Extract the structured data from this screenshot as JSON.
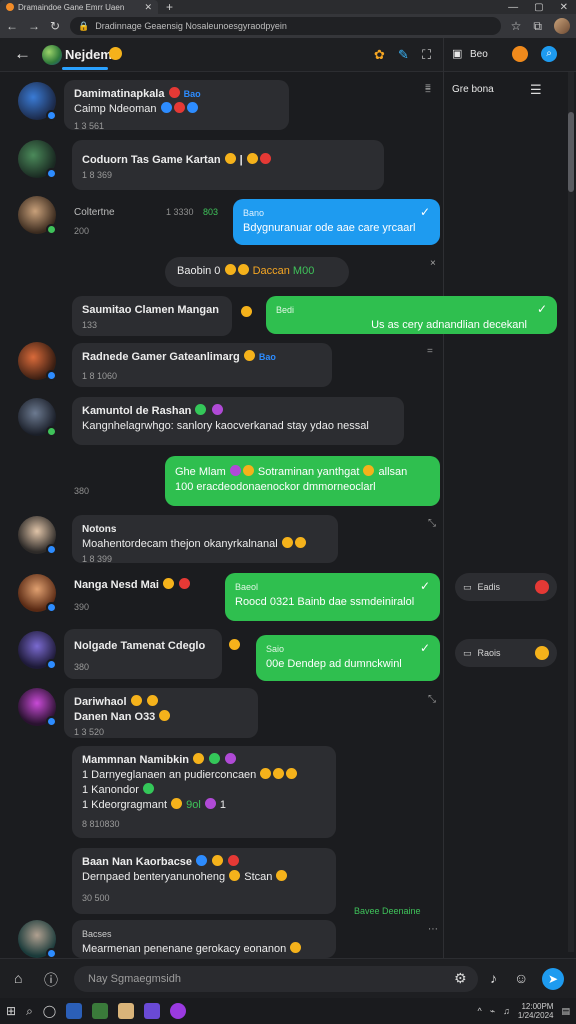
{
  "browser": {
    "tab_title": "Dramaindoe Gane Emrr Uaen",
    "address": "Dradinnage Geaensig Nosaleunoesgyraodpyein",
    "window_controls": [
      "—",
      "▢",
      "✕"
    ]
  },
  "header": {
    "back_icon": "←",
    "group_name": "Nejdem",
    "right_label": "Beo"
  },
  "right_panel": {
    "top_label": "Gre bona",
    "chips": [
      {
        "label": "Eadis",
        "color": "#e53935"
      },
      {
        "label": "Raois",
        "color": "#f5b21b"
      }
    ]
  },
  "messages": [
    {
      "name": "Damimatinapkala",
      "text": "Caimp Ndeoman",
      "extra": "Bao",
      "time": "1 3 561"
    },
    {
      "name": "Coduorn Tas Game Kartan",
      "text": "",
      "extra": "",
      "time": "1 8 369"
    },
    {
      "name": "Coltertne",
      "text": "",
      "time": "1 3330",
      "status": "803",
      "sub": "200"
    },
    {
      "out_title": "Bano",
      "out_text": "Bdygnuranuar ode aae care yrcaarl"
    },
    {
      "center_pill": "Baobin 0",
      "pill_extra": "Daccan",
      "pill_code": "M00"
    },
    {
      "name": "Saumitao Clamen Mangan",
      "time": "133"
    },
    {
      "out_title": "Bedi",
      "out_text": "Us as cery adnandlian decekanl"
    },
    {
      "name": "Radnede Gamer Gateanlimarg",
      "extra": "Bao",
      "time": "1 8 1060"
    },
    {
      "name": "Kamuntol de Rashan",
      "text": "Kangnhelagrwhgo: sanlory kaocverkanad stay ydao nessal"
    },
    {
      "out_title": "Ghe Mlam",
      "out_text1": "Sotraminan yanthgat",
      "out_extra": "allsan",
      "out_text2": "100 eracdeodonaenockor dmmorneoclarl"
    },
    {
      "small_time": "380"
    },
    {
      "name": "Notons",
      "text": "Moahentordecam thejon okanyrkalnanal",
      "time": "1 8 399"
    },
    {
      "name": "Nanga Nesd Mai",
      "time": "390"
    },
    {
      "out_title": "Baeol",
      "out_text": "Roocd 0321 Bainb dae ssmdeiniralol"
    },
    {
      "name": "Nolgade Tamenat Cdeglo",
      "time": "380"
    },
    {
      "out_title": "Saio",
      "out_text": "00e Dendep ad dumnckwinl"
    },
    {
      "name": "Dariwhaol",
      "text": "Danen Nan O33",
      "time": "1 3 520"
    },
    {
      "name": "Mammnan Namibkin",
      "lines": [
        "1 Darnyeglanaen an pudierconcaen",
        "1 Kanondor",
        "1 Kdeorgragmant"
      ],
      "tail": "9ol",
      "time": "8 810830"
    },
    {
      "name": "Baan Nan Kaorbacse",
      "text": "Dernpaed benteryanunoheng",
      "extra": "Stcan",
      "time": "30 500"
    },
    {
      "small_right": "Bavee Deenaine"
    },
    {
      "name": "Bacses",
      "text": "Mearmenan penenane gerokacy eonanon"
    }
  ],
  "input": {
    "placeholder": "Nay Sgmaegmsidh"
  },
  "taskbar": {
    "clock_time": "12:00PM",
    "clock_date": "1/24/2024"
  }
}
